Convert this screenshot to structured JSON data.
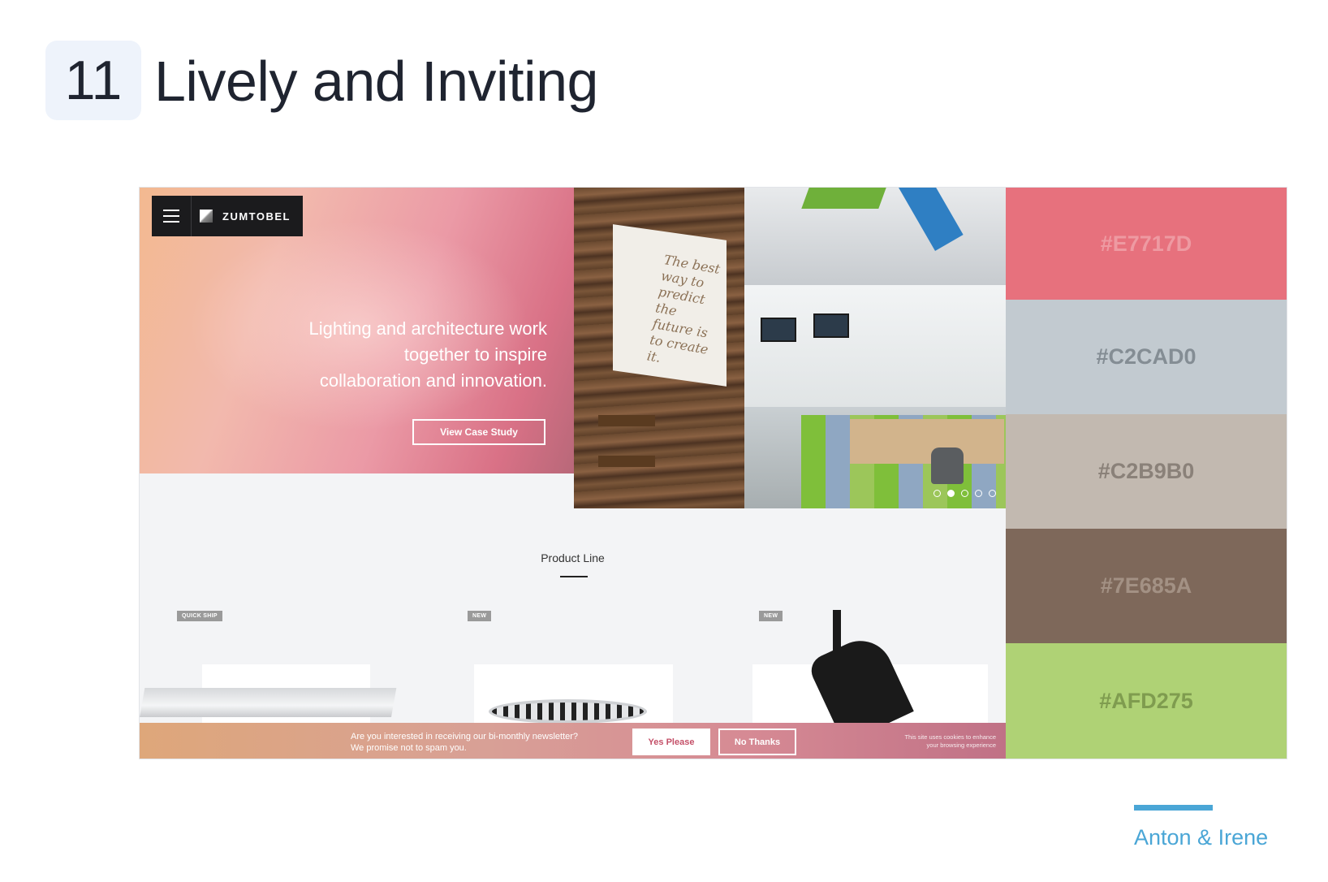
{
  "header": {
    "number": "11",
    "title": "Lively and Inviting"
  },
  "site": {
    "logo_text": "ZUMTOBEL",
    "hero_lines": [
      "Lighting and architecture work",
      "together to inspire",
      "collaboration and innovation."
    ],
    "case_study_button": "View Case Study",
    "photo_quote": "The best way to predict the future is to create it.",
    "carousel": {
      "count": 5,
      "active": 2
    },
    "product_line_title": "Product Line",
    "tags": [
      "QUICK SHIP",
      "NEW",
      "NEW"
    ],
    "newsletter": {
      "line1": "Are you interested in receiving our bi-monthly newsletter?",
      "line2": "We promise not to spam you.",
      "yes_label": "Yes Please",
      "no_label": "No Thanks",
      "cookie_line1": "This site uses cookies to enhance",
      "cookie_line2": "your browsing experience"
    }
  },
  "palette": [
    {
      "hex": "#E7717D",
      "label": "#E7717D",
      "text_color": "#ee9aa2"
    },
    {
      "hex": "#C2CAD0",
      "label": "#C2CAD0",
      "text_color": "#848d94"
    },
    {
      "hex": "#C2B9B0",
      "label": "#C2B9B0",
      "text_color": "#8a8179"
    },
    {
      "hex": "#7E685A",
      "label": "#7E685A",
      "text_color": "#a39184"
    },
    {
      "hex": "#AFD275",
      "label": "#AFD275",
      "text_color": "#7f9c4f"
    }
  ],
  "author": "Anton & Irene",
  "colors": {
    "title": "#1f2430",
    "badge_bg": "#eef3fb",
    "accent": "#4aa6d6"
  }
}
